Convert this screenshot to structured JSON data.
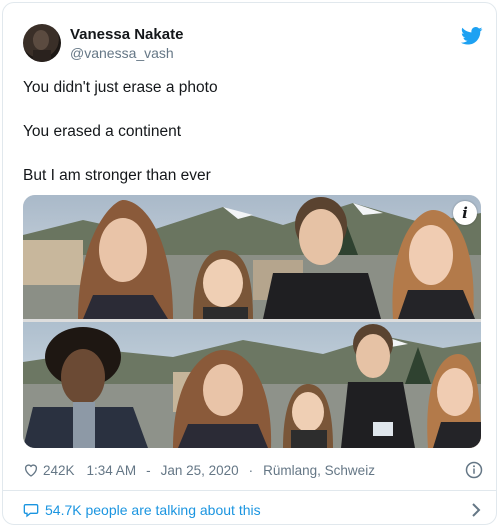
{
  "tweet": {
    "author_name": "Vanessa Nakate",
    "author_handle": "@vanessa_vash",
    "lines": [
      "You didn't just erase a photo",
      "You erased a continent",
      "But I am stronger than ever"
    ],
    "likes": "242K",
    "time": "1:34 AM",
    "date": "Jan 25, 2020",
    "location": "Rümlang, Schweiz",
    "conversation": "54.7K people are talking about this"
  },
  "colors": {
    "brand": "#1da1f2",
    "link": "#1b95e0",
    "muted": "#657786"
  },
  "icons": [
    "twitter-bird-icon",
    "info-i-icon",
    "heart-icon",
    "info-circle-icon",
    "speech-bubble-icon",
    "chevron-right-icon"
  ]
}
